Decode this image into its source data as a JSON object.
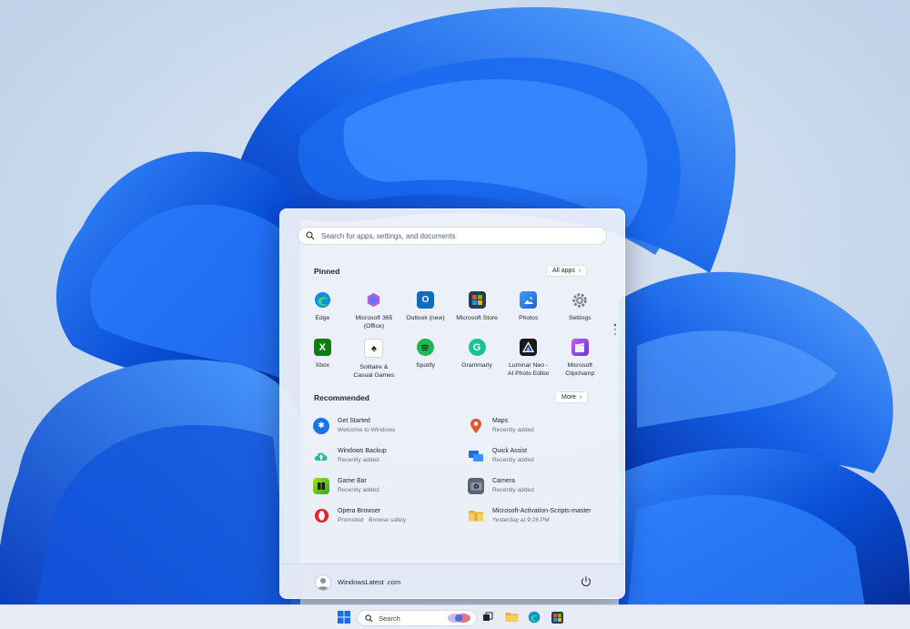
{
  "start_menu": {
    "search_placeholder": "Search for apps, settings, and documents",
    "pinned_title": "Pinned",
    "all_apps_label": "All apps",
    "recommended_title": "Recommended",
    "more_label": "More",
    "pinned": [
      {
        "label": "Edge",
        "icon": "edge-icon"
      },
      {
        "label": "Microsoft 365\n(Office)",
        "icon": "microsoft-365-icon"
      },
      {
        "label": "Outlook (new)",
        "icon": "outlook-icon"
      },
      {
        "label": "Microsoft Store",
        "icon": "store-icon"
      },
      {
        "label": "Photos",
        "icon": "photos-icon"
      },
      {
        "label": "Settings",
        "icon": "gear-icon"
      },
      {
        "label": "Xbox",
        "icon": "xbox-icon"
      },
      {
        "label": "Solitaire &\nCasual Games",
        "icon": "solitaire-icon"
      },
      {
        "label": "Spotify",
        "icon": "spotify-icon"
      },
      {
        "label": "Grammarly",
        "icon": "grammarly-icon"
      },
      {
        "label": "Luminar Neo -\nAI Photo Editor",
        "icon": "luminar-icon"
      },
      {
        "label": "Microsoft\nClipchamp",
        "icon": "clipchamp-icon"
      }
    ],
    "recommended": [
      {
        "name": "Get Started",
        "sub": "Welcome to Windows",
        "icon": "get-started-icon"
      },
      {
        "name": "Maps",
        "sub": "Recently added",
        "icon": "maps-icon"
      },
      {
        "name": "Windows Backup",
        "sub": "Recently added",
        "icon": "backup-icon"
      },
      {
        "name": "Quick Assist",
        "sub": "Recently added",
        "icon": "quick-assist-icon"
      },
      {
        "name": "Game Bar",
        "sub": "Recently added",
        "icon": "game-bar-icon"
      },
      {
        "name": "Camera",
        "sub": "Recently added",
        "icon": "camera-icon"
      },
      {
        "name": "Opera Browser",
        "sub": "Promoted   Browse safely",
        "icon": "opera-icon"
      },
      {
        "name": "Microsoft-Activation-Scripts-master",
        "sub": "Yesterday at 9:28 PM",
        "icon": "folder-icon"
      }
    ],
    "user_name": "WindowsLatest .com"
  },
  "taskbar": {
    "search_label": "Search"
  },
  "colors": {
    "accent": "#0a5bd8",
    "wallpaper_bg": "#c9d9ec"
  }
}
